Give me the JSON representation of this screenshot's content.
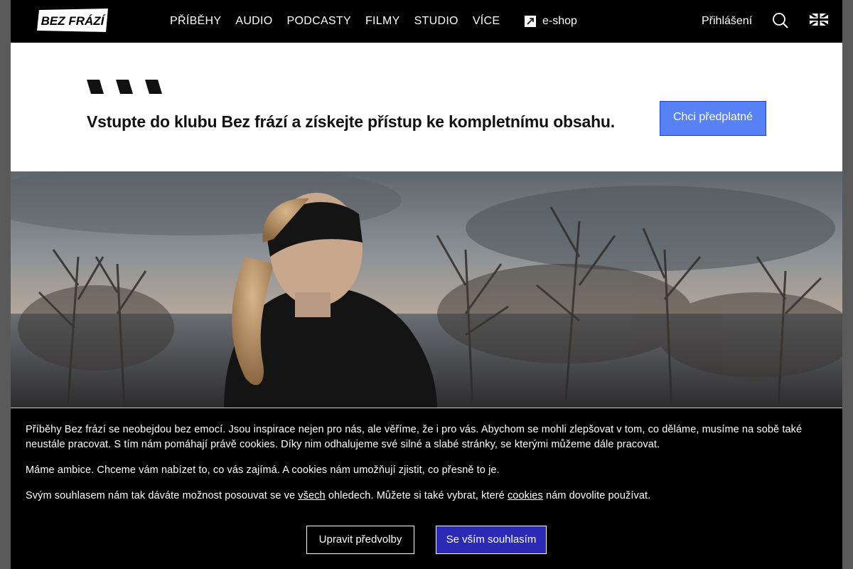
{
  "header": {
    "logo_text": "BEZ FRÁZÍ",
    "nav": [
      "PŘÍBĚHY",
      "AUDIO",
      "PODCASTY",
      "FILMY",
      "STUDIO",
      "VÍCE"
    ],
    "eshop_label": "e-shop",
    "login_label": "Přihlášení",
    "icons": {
      "search": "search-icon",
      "language": "uk-flag-icon",
      "eshop": "external-link-icon"
    }
  },
  "promo": {
    "text": "Vstupte do klubu Bez frází a získejte přístup ke kompletnímu obsahu.",
    "button_label": "Chci předplatné",
    "button_color": "#5881f5"
  },
  "cookie": {
    "p1": "Příběhy Bez frází se neobejdou bez emocí. Jsou inspirace nejen pro nás, ale věříme, že i pro vás. Abychom se mohli zlepšovat v tom, co děláme, musíme na sobě také neustále pracovat. S tím nám pomáhají právě cookies. Díky nim odhalujeme své silné a slabé stránky, se kterými můžeme dále pracovat.",
    "p2": "Máme ambice. Chceme vám nabízet to, co vás zajímá. A cookies nám umožňují zjistit, co přesně to je.",
    "p3_a": "Svým souhlasem nám tak dáváte možnost posouvat se ve ",
    "p3_link1": "všech",
    "p3_b": " ohledech. Můžete si také vybrat, které ",
    "p3_link2": "cookies",
    "p3_c": " nám dovolite používat.",
    "btn_prefs": "Upravit předvolby",
    "btn_accept": "Se vším souhlasím",
    "accept_color": "#2a2ab5"
  }
}
